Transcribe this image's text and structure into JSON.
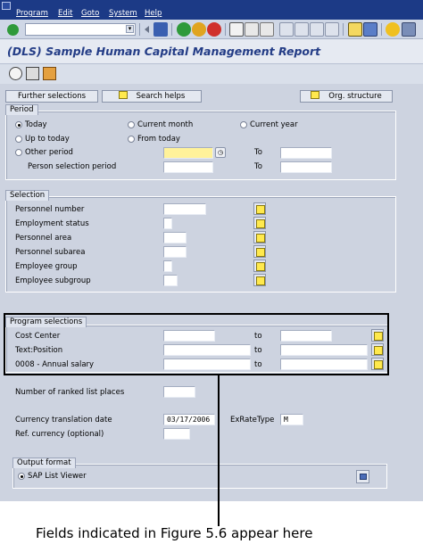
{
  "menu": [
    "Program",
    "Edit",
    "Goto",
    "System",
    "Help"
  ],
  "title": "(DLS) Sample Human Capital Management Report",
  "buttons": {
    "further_selections": "Further selections",
    "search_helps": "Search helps",
    "org_structure": "Org. structure"
  },
  "period": {
    "title": "Period",
    "today": "Today",
    "current_month": "Current month",
    "current_year": "Current year",
    "up_to_today": "Up to today",
    "from_today": "From today",
    "other_period": "Other period",
    "person_selection_period": "Person selection period",
    "to": "To",
    "selected": "Today"
  },
  "selection": {
    "title": "Selection",
    "rows": [
      "Personnel number",
      "Employment status",
      "Personnel area",
      "Personnel subarea",
      "Employee group",
      "Employee subgroup"
    ]
  },
  "program_selections": {
    "title": "Program selections",
    "rows": [
      "Cost Center",
      "Text:Position",
      "0008 - Annual salary"
    ],
    "to": "to"
  },
  "options": {
    "ranked_list_places": "Number of ranked list places",
    "currency_translation_date": "Currency translation date",
    "currency_translation_date_value": "03/17/2006",
    "ex_rate_type": "ExRateType",
    "ex_rate_type_value": "M",
    "ref_currency": "Ref. currency (optional)"
  },
  "output_format": {
    "title": "Output format",
    "sap_list_viewer": "SAP List Viewer"
  },
  "caption": "Fields indicated in Figure 5.6 appear here",
  "colors": {
    "menubar": "#1c3a86",
    "title": "#233c86",
    "required_field": "#fff29a",
    "background": "#cdd3e0",
    "arrow_icon": "#ffe94d"
  }
}
